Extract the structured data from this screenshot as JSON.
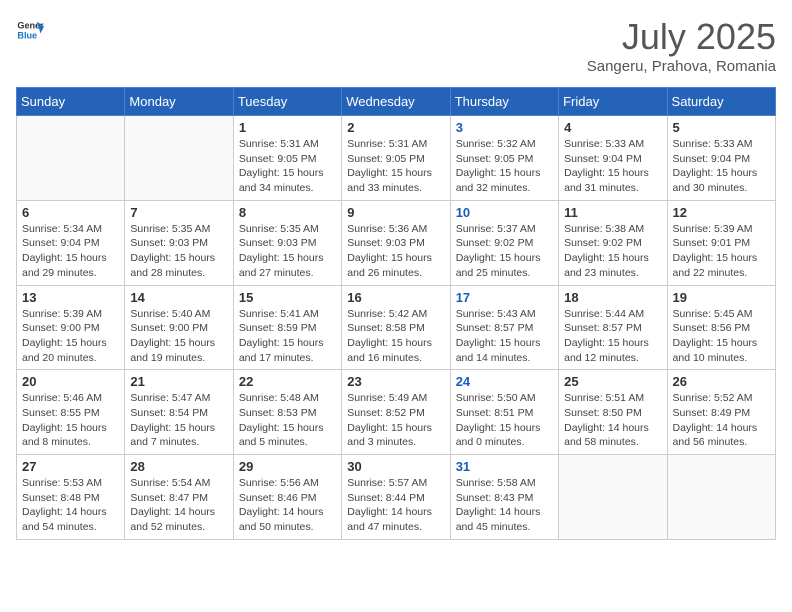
{
  "header": {
    "logo_line1": "General",
    "logo_line2": "Blue",
    "month_year": "July 2025",
    "location": "Sangeru, Prahova, Romania"
  },
  "weekdays": [
    "Sunday",
    "Monday",
    "Tuesday",
    "Wednesday",
    "Thursday",
    "Friday",
    "Saturday"
  ],
  "weeks": [
    [
      {
        "day": "",
        "info": ""
      },
      {
        "day": "",
        "info": ""
      },
      {
        "day": "1",
        "info": "Sunrise: 5:31 AM\nSunset: 9:05 PM\nDaylight: 15 hours and 34 minutes."
      },
      {
        "day": "2",
        "info": "Sunrise: 5:31 AM\nSunset: 9:05 PM\nDaylight: 15 hours and 33 minutes."
      },
      {
        "day": "3",
        "info": "Sunrise: 5:32 AM\nSunset: 9:05 PM\nDaylight: 15 hours and 32 minutes."
      },
      {
        "day": "4",
        "info": "Sunrise: 5:33 AM\nSunset: 9:04 PM\nDaylight: 15 hours and 31 minutes."
      },
      {
        "day": "5",
        "info": "Sunrise: 5:33 AM\nSunset: 9:04 PM\nDaylight: 15 hours and 30 minutes."
      }
    ],
    [
      {
        "day": "6",
        "info": "Sunrise: 5:34 AM\nSunset: 9:04 PM\nDaylight: 15 hours and 29 minutes."
      },
      {
        "day": "7",
        "info": "Sunrise: 5:35 AM\nSunset: 9:03 PM\nDaylight: 15 hours and 28 minutes."
      },
      {
        "day": "8",
        "info": "Sunrise: 5:35 AM\nSunset: 9:03 PM\nDaylight: 15 hours and 27 minutes."
      },
      {
        "day": "9",
        "info": "Sunrise: 5:36 AM\nSunset: 9:03 PM\nDaylight: 15 hours and 26 minutes."
      },
      {
        "day": "10",
        "info": "Sunrise: 5:37 AM\nSunset: 9:02 PM\nDaylight: 15 hours and 25 minutes."
      },
      {
        "day": "11",
        "info": "Sunrise: 5:38 AM\nSunset: 9:02 PM\nDaylight: 15 hours and 23 minutes."
      },
      {
        "day": "12",
        "info": "Sunrise: 5:39 AM\nSunset: 9:01 PM\nDaylight: 15 hours and 22 minutes."
      }
    ],
    [
      {
        "day": "13",
        "info": "Sunrise: 5:39 AM\nSunset: 9:00 PM\nDaylight: 15 hours and 20 minutes."
      },
      {
        "day": "14",
        "info": "Sunrise: 5:40 AM\nSunset: 9:00 PM\nDaylight: 15 hours and 19 minutes."
      },
      {
        "day": "15",
        "info": "Sunrise: 5:41 AM\nSunset: 8:59 PM\nDaylight: 15 hours and 17 minutes."
      },
      {
        "day": "16",
        "info": "Sunrise: 5:42 AM\nSunset: 8:58 PM\nDaylight: 15 hours and 16 minutes."
      },
      {
        "day": "17",
        "info": "Sunrise: 5:43 AM\nSunset: 8:57 PM\nDaylight: 15 hours and 14 minutes."
      },
      {
        "day": "18",
        "info": "Sunrise: 5:44 AM\nSunset: 8:57 PM\nDaylight: 15 hours and 12 minutes."
      },
      {
        "day": "19",
        "info": "Sunrise: 5:45 AM\nSunset: 8:56 PM\nDaylight: 15 hours and 10 minutes."
      }
    ],
    [
      {
        "day": "20",
        "info": "Sunrise: 5:46 AM\nSunset: 8:55 PM\nDaylight: 15 hours and 8 minutes."
      },
      {
        "day": "21",
        "info": "Sunrise: 5:47 AM\nSunset: 8:54 PM\nDaylight: 15 hours and 7 minutes."
      },
      {
        "day": "22",
        "info": "Sunrise: 5:48 AM\nSunset: 8:53 PM\nDaylight: 15 hours and 5 minutes."
      },
      {
        "day": "23",
        "info": "Sunrise: 5:49 AM\nSunset: 8:52 PM\nDaylight: 15 hours and 3 minutes."
      },
      {
        "day": "24",
        "info": "Sunrise: 5:50 AM\nSunset: 8:51 PM\nDaylight: 15 hours and 0 minutes."
      },
      {
        "day": "25",
        "info": "Sunrise: 5:51 AM\nSunset: 8:50 PM\nDaylight: 14 hours and 58 minutes."
      },
      {
        "day": "26",
        "info": "Sunrise: 5:52 AM\nSunset: 8:49 PM\nDaylight: 14 hours and 56 minutes."
      }
    ],
    [
      {
        "day": "27",
        "info": "Sunrise: 5:53 AM\nSunset: 8:48 PM\nDaylight: 14 hours and 54 minutes."
      },
      {
        "day": "28",
        "info": "Sunrise: 5:54 AM\nSunset: 8:47 PM\nDaylight: 14 hours and 52 minutes."
      },
      {
        "day": "29",
        "info": "Sunrise: 5:56 AM\nSunset: 8:46 PM\nDaylight: 14 hours and 50 minutes."
      },
      {
        "day": "30",
        "info": "Sunrise: 5:57 AM\nSunset: 8:44 PM\nDaylight: 14 hours and 47 minutes."
      },
      {
        "day": "31",
        "info": "Sunrise: 5:58 AM\nSunset: 8:43 PM\nDaylight: 14 hours and 45 minutes."
      },
      {
        "day": "",
        "info": ""
      },
      {
        "day": "",
        "info": ""
      }
    ]
  ]
}
